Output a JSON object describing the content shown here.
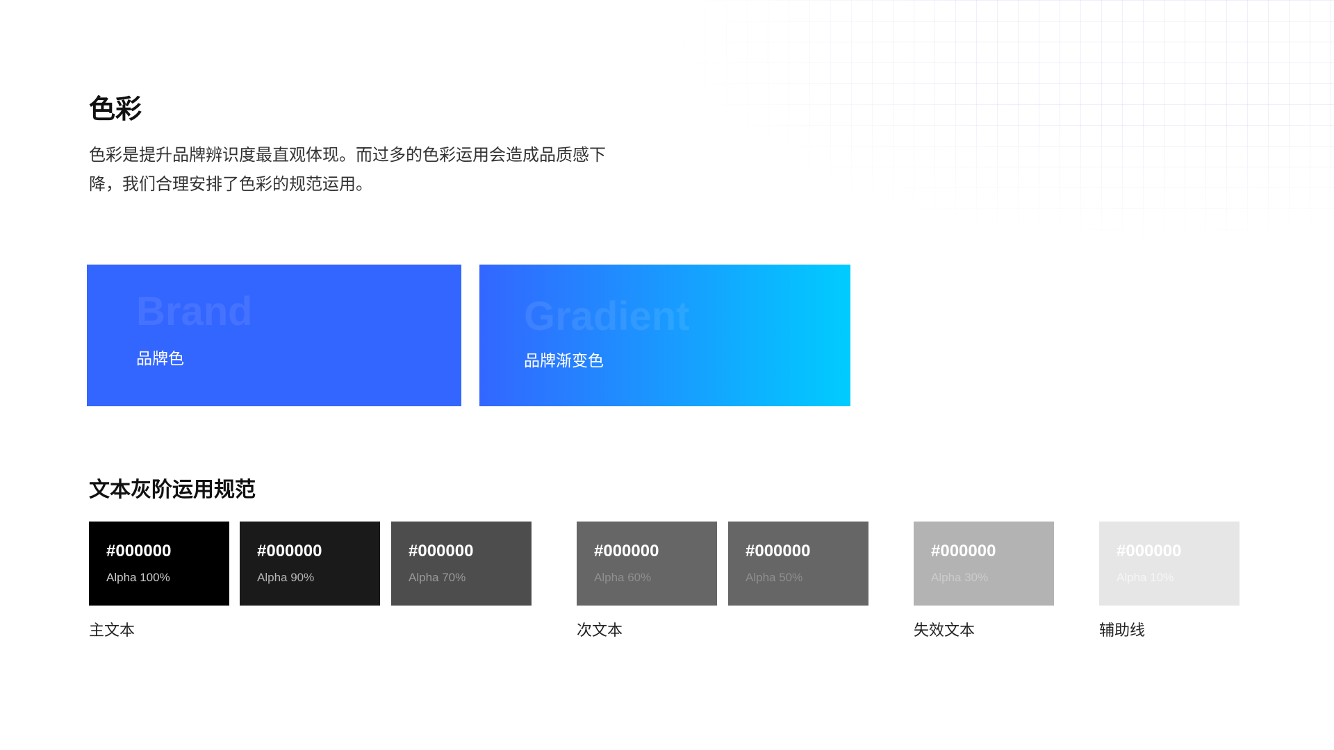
{
  "title": "色彩",
  "description": "色彩是提升品牌辨识度最直观体现。而过多的色彩运用会造成品质感下降，我们合理安排了色彩的规范运用。",
  "brand_card": {
    "label_en": "Brand",
    "label_zh": "品牌色",
    "color": "#3366FF"
  },
  "gradient_card": {
    "label_en": "Gradient",
    "label_zh": "品牌渐变色",
    "color_start": "#3366FF",
    "color_end": "#00CCFF"
  },
  "text_gray_section": {
    "title": "文本灰阶运用规范",
    "swatches": [
      {
        "hex": "#000000",
        "alpha": "Alpha 100%",
        "fill": "#000000",
        "alpha_text_color": "#cccccc"
      },
      {
        "hex": "#000000",
        "alpha": "Alpha 90%",
        "fill": "#1a1a1a",
        "alpha_text_color": "#b5b5b5"
      },
      {
        "hex": "#000000",
        "alpha": "Alpha 70%",
        "fill": "#4d4d4d",
        "alpha_text_color": "#9a9a9a"
      },
      {
        "hex": "#000000",
        "alpha": "Alpha 60%",
        "fill": "#666666",
        "alpha_text_color": "#8f8f8f"
      },
      {
        "hex": "#000000",
        "alpha": "Alpha 50%",
        "fill": "#666666",
        "alpha_text_color": "#8f8f8f"
      },
      {
        "hex": "#000000",
        "alpha": "Alpha 30%",
        "fill": "#b3b3b3",
        "alpha_text_color": "#cbcbcb"
      },
      {
        "hex": "#000000",
        "alpha": "Alpha 10%",
        "fill": "#e6e6e6",
        "alpha_text_color": "#f6f6f6"
      }
    ],
    "groups": [
      {
        "label": "主文本"
      },
      {
        "label": "次文本"
      },
      {
        "label": "失效文本"
      },
      {
        "label": "辅助线"
      }
    ]
  }
}
